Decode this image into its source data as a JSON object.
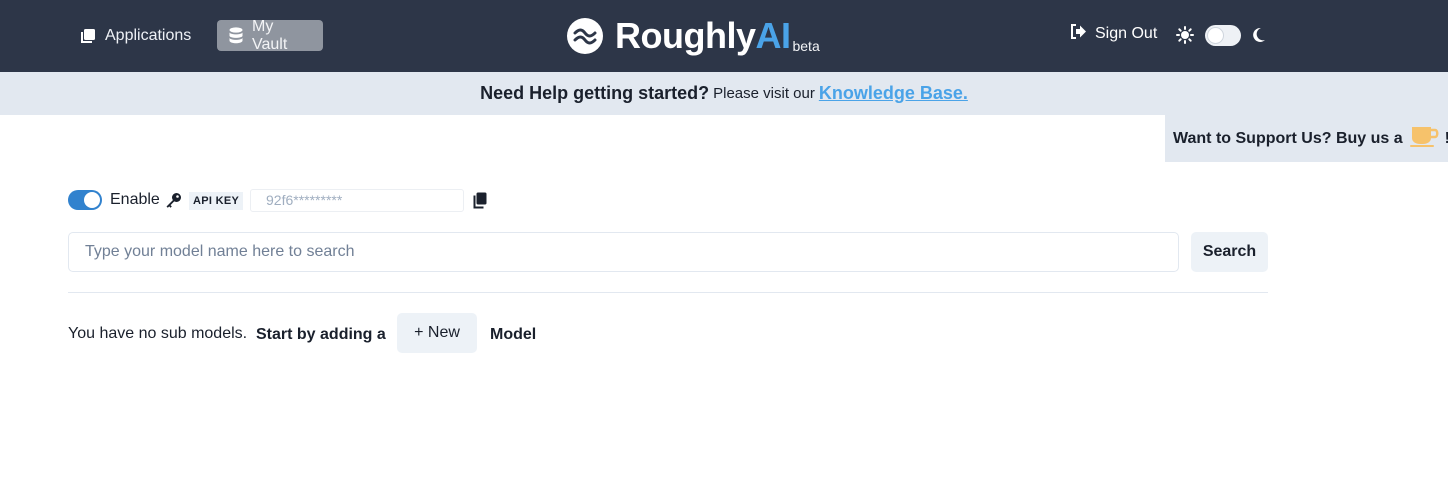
{
  "nav": {
    "applications_label": "Applications",
    "vault_label": "My Vault",
    "brand_name": "Roughly",
    "brand_accent": "AI",
    "brand_badge": "beta",
    "signout_label": "Sign Out",
    "icons": [
      "applications-icon",
      "database-icon",
      "wave-logo-icon",
      "sign-out-icon",
      "sun-icon",
      "moon-icon"
    ]
  },
  "help": {
    "lead": "Need Help getting started?",
    "text": "Please visit our",
    "link": "Knowledge Base."
  },
  "support": {
    "text": "Want to Support Us?  Buy us a",
    "suffix": "!"
  },
  "api": {
    "enable_label": "Enable",
    "badge": "API KEY",
    "key_value": "92f6*********"
  },
  "search": {
    "placeholder": "Type your model name here to search",
    "button_label": "Search"
  },
  "empty": {
    "text": "You have no sub models.",
    "lead": "Start by adding a",
    "new_label": "+ New",
    "trail": "Model"
  },
  "colors": {
    "header_bg": "#2d3648",
    "accent": "#4aa3e8",
    "banner_bg": "#e2e8f0",
    "toggle_on": "#3182ce"
  }
}
